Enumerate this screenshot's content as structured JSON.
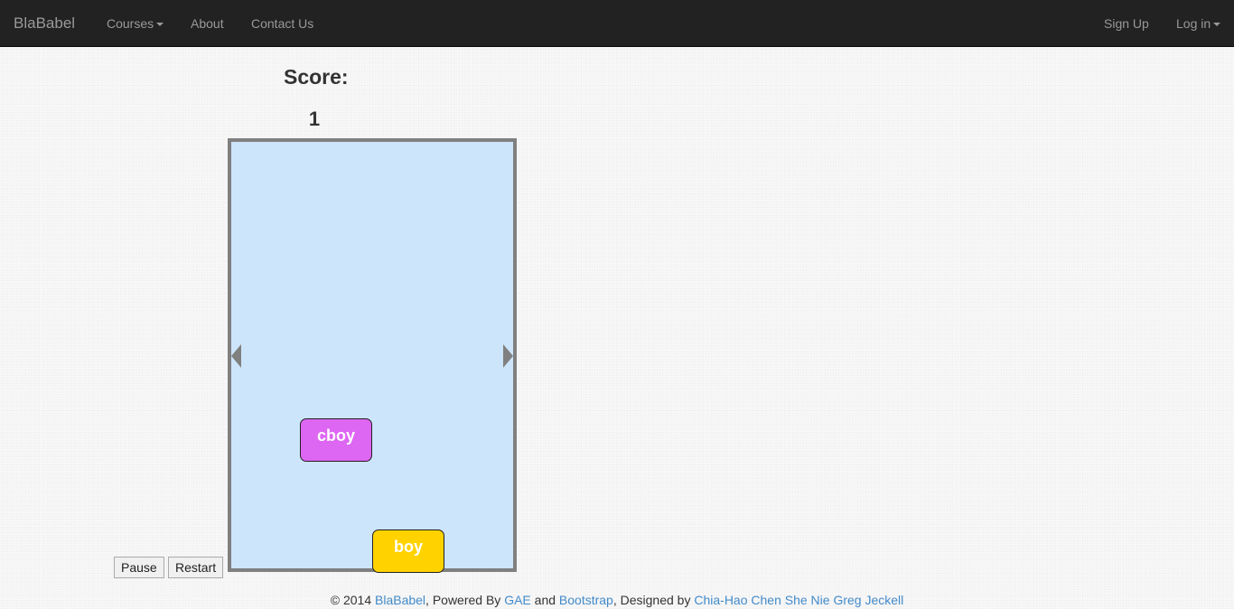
{
  "navbar": {
    "brand": "BlaBabel",
    "left_items": [
      "Courses",
      "About",
      "Contact Us"
    ],
    "right_items": [
      "Sign Up",
      "Log in"
    ]
  },
  "game": {
    "score_label": "Score:",
    "score_value": "1",
    "falling_word": "cboy",
    "player_word": "boy",
    "colors": {
      "board": "#cce5fb",
      "board_border": "#808080",
      "falling_block": "#dd66f2",
      "player_block": "#ffd200"
    }
  },
  "controls": {
    "pause_label": "Pause",
    "restart_label": "Restart"
  },
  "footer": {
    "prefix": "© 2014 ",
    "brand_link": "BlaBabel",
    "powered_by": ", Powered By ",
    "gae_link": "GAE",
    "and_text": " and ",
    "bootstrap_link": "Bootstrap",
    "designed_by": ", Designed by ",
    "authors_link": "Chia-Hao Chen She Nie Greg Jeckell"
  }
}
